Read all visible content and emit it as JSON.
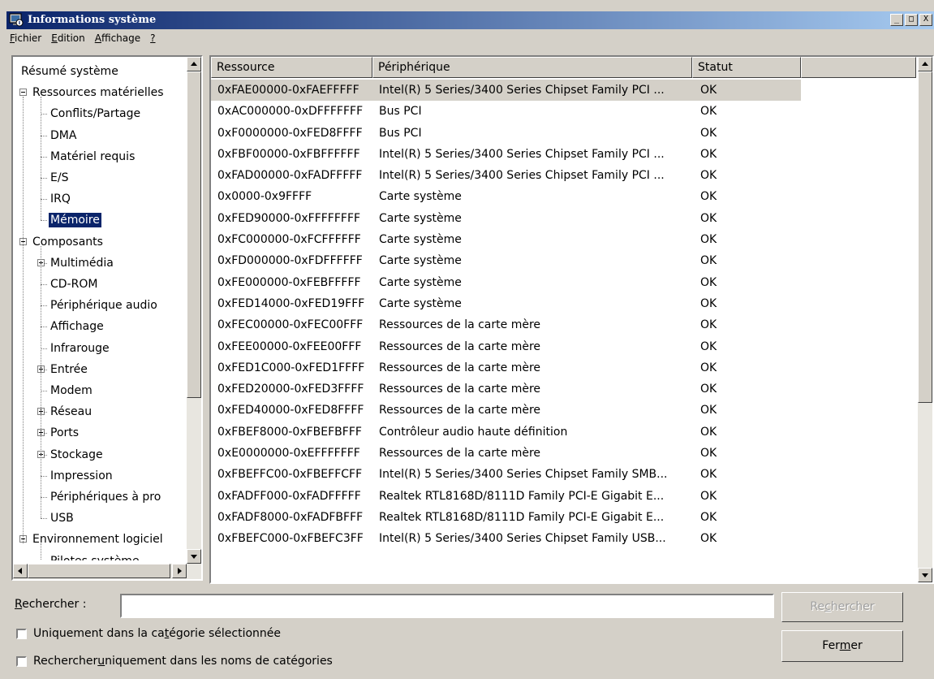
{
  "window": {
    "title": "Informations système",
    "min_glyph": "_",
    "max_glyph": "□",
    "close_glyph": "X"
  },
  "menu": {
    "items": [
      {
        "pre": "",
        "u": "F",
        "post": "ichier"
      },
      {
        "pre": "",
        "u": "E",
        "post": "dition"
      },
      {
        "pre": "",
        "u": "A",
        "post": "ffichage"
      },
      {
        "pre": "",
        "u": "?",
        "post": ""
      }
    ]
  },
  "tree": {
    "items": [
      {
        "label": "Résumé système"
      },
      {
        "label": "Ressources matérielles"
      },
      {
        "label": "Conflits/Partage"
      },
      {
        "label": "DMA"
      },
      {
        "label": "Matériel requis"
      },
      {
        "label": "E/S"
      },
      {
        "label": "IRQ"
      },
      {
        "label": "Mémoire"
      },
      {
        "label": "Composants"
      },
      {
        "label": "Multimédia"
      },
      {
        "label": "CD-ROM"
      },
      {
        "label": "Périphérique audio"
      },
      {
        "label": "Affichage"
      },
      {
        "label": "Infrarouge"
      },
      {
        "label": "Entrée"
      },
      {
        "label": "Modem"
      },
      {
        "label": "Réseau"
      },
      {
        "label": "Ports"
      },
      {
        "label": "Stockage"
      },
      {
        "label": "Impression"
      },
      {
        "label": "Périphériques à pro"
      },
      {
        "label": "USB"
      },
      {
        "label": "Environnement logiciel"
      },
      {
        "label": "Pilotes système"
      }
    ]
  },
  "table": {
    "columns": [
      "Ressource",
      "Périphérique",
      "Statut"
    ],
    "rows": [
      [
        "0xFAE00000-0xFAEFFFFF",
        "Intel(R) 5 Series/3400 Series Chipset Family PCI ...",
        "OK"
      ],
      [
        "0xAC000000-0xDFFFFFFF",
        "Bus PCI",
        "OK"
      ],
      [
        "0xF0000000-0xFED8FFFF",
        "Bus PCI",
        "OK"
      ],
      [
        "0xFBF00000-0xFBFFFFFF",
        "Intel(R) 5 Series/3400 Series Chipset Family PCI ...",
        "OK"
      ],
      [
        "0xFAD00000-0xFADFFFFF",
        "Intel(R) 5 Series/3400 Series Chipset Family PCI ...",
        "OK"
      ],
      [
        "0x0000-0x9FFFF",
        "Carte système",
        "OK"
      ],
      [
        "0xFED90000-0xFFFFFFFF",
        "Carte système",
        "OK"
      ],
      [
        "0xFC000000-0xFCFFFFFF",
        "Carte système",
        "OK"
      ],
      [
        "0xFD000000-0xFDFFFFFF",
        "Carte système",
        "OK"
      ],
      [
        "0xFE000000-0xFEBFFFFF",
        "Carte système",
        "OK"
      ],
      [
        "0xFED14000-0xFED19FFF",
        "Carte système",
        "OK"
      ],
      [
        "0xFEC00000-0xFEC00FFF",
        "Ressources de la carte mère",
        "OK"
      ],
      [
        "0xFEE00000-0xFEE00FFF",
        "Ressources de la carte mère",
        "OK"
      ],
      [
        "0xFED1C000-0xFED1FFFF",
        "Ressources de la carte mère",
        "OK"
      ],
      [
        "0xFED20000-0xFED3FFFF",
        "Ressources de la carte mère",
        "OK"
      ],
      [
        "0xFED40000-0xFED8FFFF",
        "Ressources de la carte mère",
        "OK"
      ],
      [
        "0xFBEF8000-0xFBEFBFFF",
        "Contrôleur audio haute définition",
        "OK"
      ],
      [
        "0xE0000000-0xEFFFFFFF",
        "Ressources de la carte mère",
        "OK"
      ],
      [
        "0xFBEFFC00-0xFBEFFCFF",
        "Intel(R) 5 Series/3400 Series Chipset Family SMB...",
        "OK"
      ],
      [
        "0xFADFF000-0xFADFFFFF",
        "Realtek RTL8168D/8111D Family PCI-E Gigabit E...",
        "OK"
      ],
      [
        "0xFADF8000-0xFADFBFFF",
        "Realtek RTL8168D/8111D Family PCI-E Gigabit E...",
        "OK"
      ],
      [
        "0xFBEFC000-0xFBEFC3FF",
        "Intel(R) 5 Series/3400 Series Chipset Family USB...",
        "OK"
      ]
    ]
  },
  "search": {
    "label_pre": "",
    "label_u": "R",
    "label_post": "echercher :",
    "value": "",
    "button_pre": "Re",
    "button_u": "c",
    "button_post": "hercher",
    "close_pre": "Fer",
    "close_u": "m",
    "close_post": "er",
    "option1_pre": "Uniquement dans la ca",
    "option1_u": "t",
    "option1_post": "égorie sélectionnée",
    "option2_pre": "Rechercher ",
    "option2_u": "u",
    "option2_post": "niquement dans les noms de catégories"
  }
}
